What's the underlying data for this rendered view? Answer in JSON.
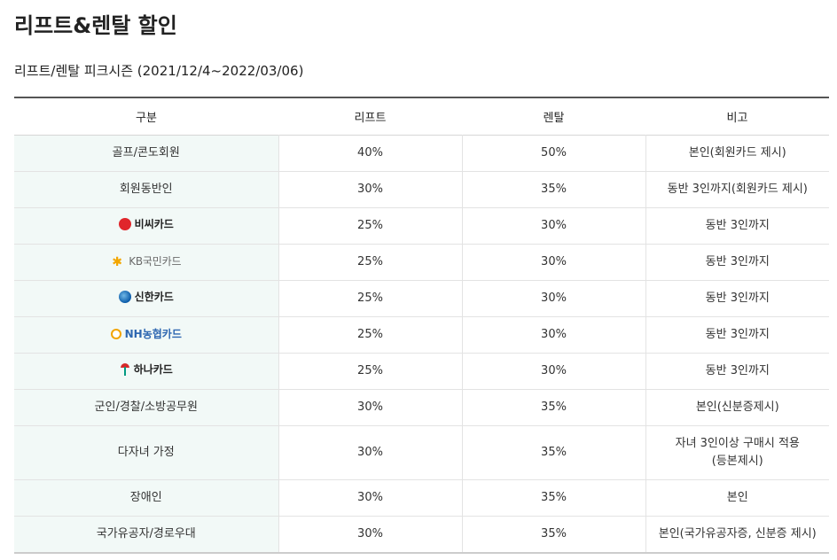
{
  "page": {
    "title": "리프트&렌탈 할인",
    "subtitle": "리프트/렌탈 피크시즌 (2021/12/4~2022/03/06)"
  },
  "table": {
    "headers": [
      "구분",
      "리프트",
      "렌탈",
      "비고"
    ],
    "rows": [
      {
        "category": "골프/콘도회원",
        "lift": "40%",
        "rental": "50%",
        "note": "본인(회원카드 제시)"
      },
      {
        "category": "회원동반인",
        "lift": "30%",
        "rental": "35%",
        "note": "동반 3인까지(회원카드 제시)"
      },
      {
        "category": "비씨카드",
        "lift": "25%",
        "rental": "30%",
        "note": "동반 3인까지",
        "logo": "bc-card-logo"
      },
      {
        "category": "KB국민카드",
        "lift": "25%",
        "rental": "30%",
        "note": "동반 3인까지",
        "logo": "kb-card-logo"
      },
      {
        "category": "신한카드",
        "lift": "25%",
        "rental": "30%",
        "note": "동반 3인까지",
        "logo": "shinhan-card-logo"
      },
      {
        "category": "NH농협카드",
        "lift": "25%",
        "rental": "30%",
        "note": "동반 3인까지",
        "logo": "nh-card-logo"
      },
      {
        "category": "하나카드",
        "lift": "25%",
        "rental": "30%",
        "note": "동반 3인까지",
        "logo": "hana-card-logo"
      },
      {
        "category": "군인/경찰/소방공무원",
        "lift": "30%",
        "rental": "35%",
        "note": "본인(신분증제시)"
      },
      {
        "category": "다자녀 가정",
        "lift": "30%",
        "rental": "35%",
        "note_line1": "자녀 3인이상 구매시 적용",
        "note_line2": "(등본제시)"
      },
      {
        "category": "장애인",
        "lift": "30%",
        "rental": "35%",
        "note": "본인"
      },
      {
        "category": "국가유공자/경로우대",
        "lift": "30%",
        "rental": "35%",
        "note": "본인(국가유공자증, 신분증 제시)"
      }
    ]
  },
  "colors": {
    "first_col_bg": "#f2f9f7",
    "header_top_border": "#555555",
    "bc_red": "#e0262b",
    "kb_yellow": "#f3a600",
    "shinhan_blue": "#0a5aa8",
    "nh_blue": "#2e67b1",
    "hana_green": "#009a82"
  }
}
